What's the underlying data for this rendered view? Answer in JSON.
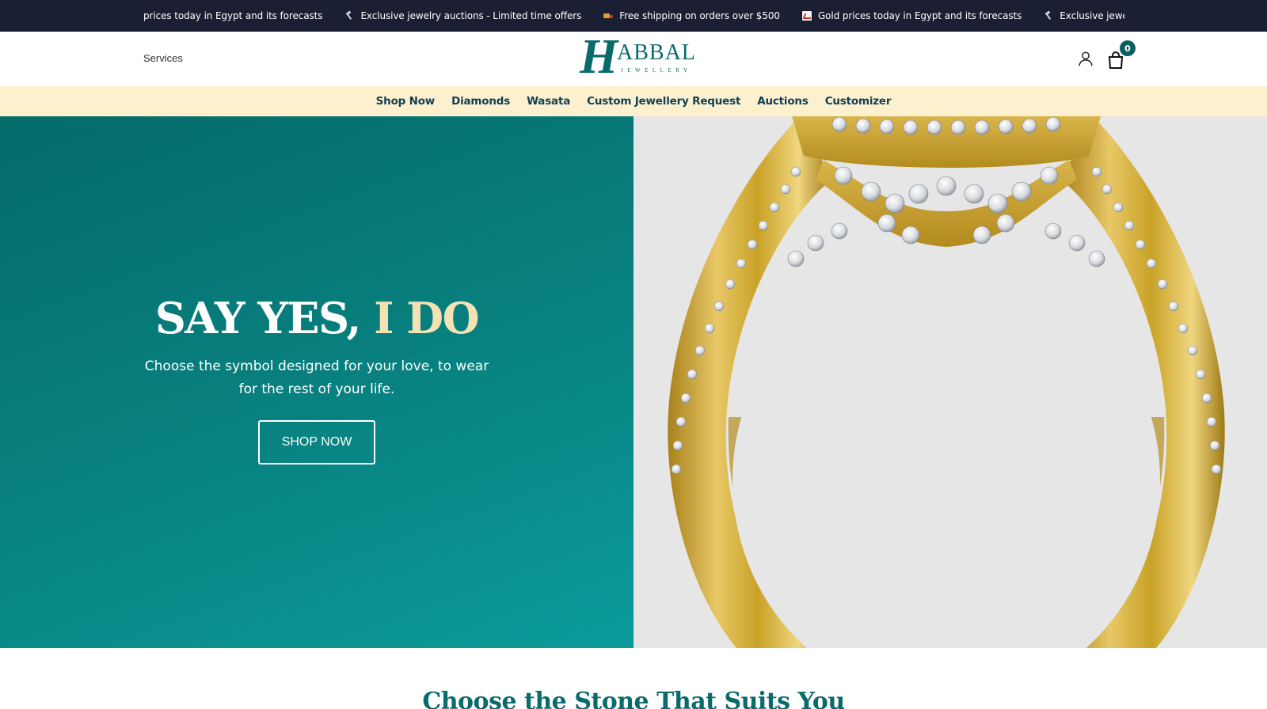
{
  "ticker": {
    "items": [
      {
        "icon": "none",
        "text": "prices today in Egypt and its forecasts"
      },
      {
        "icon": "hammer-icon",
        "text": "Exclusive jewelry auctions - Limited time offers"
      },
      {
        "icon": "truck-icon",
        "text": "Free shipping on orders over $500"
      },
      {
        "icon": "chart-icon",
        "text": "Gold prices today in Egypt and its forecasts"
      },
      {
        "icon": "hammer-icon",
        "text": "Exclusive jewelry auctions - Limited time offers"
      }
    ]
  },
  "header": {
    "services_label": "Services",
    "logo": {
      "mark": "H",
      "word": "ABBAL",
      "sub": "JEWELLERY"
    },
    "cart_count": "0"
  },
  "nav": {
    "items": [
      "Shop Now",
      "Diamonds",
      "Wasata",
      "Custom Jewellery Request",
      "Auctions",
      "Customizer"
    ]
  },
  "hero": {
    "title_main": "SAY YES, ",
    "title_accent": "I DO",
    "subtitle": "Choose the symbol designed for your love, to wear for the rest of your life.",
    "cta_label": "SHOP NOW"
  },
  "section": {
    "heading": "Choose the Stone That Suits You"
  },
  "colors": {
    "ticker_bg": "#1a1f33",
    "nav_bg": "#fdf0cf",
    "brand_teal": "#0a6b6b",
    "hero_accent": "#f3e3b4",
    "gold": "#c9a227"
  }
}
